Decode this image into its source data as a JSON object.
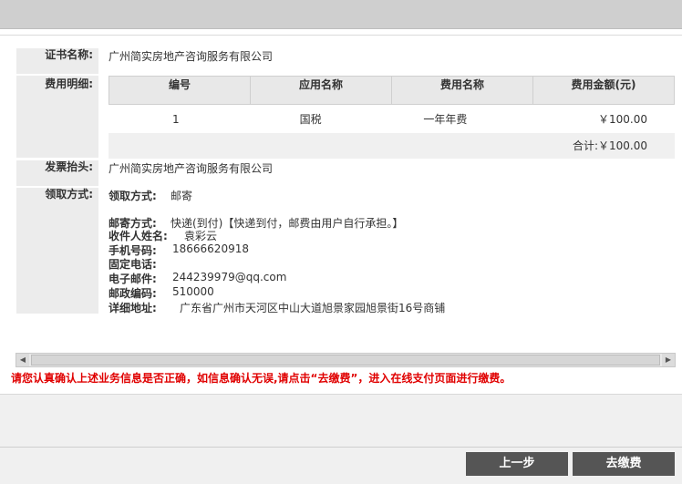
{
  "cert_name": {
    "label": "证书名称:",
    "value": "广州简实房地产咨询服务有限公司"
  },
  "fee_detail": {
    "label": "费用明细:",
    "columns": [
      "编号",
      "应用名称",
      "费用名称",
      "费用金额(元)"
    ],
    "rows": [
      {
        "no": "1",
        "app": "国税",
        "fee_name": "一年年费",
        "amount": "￥100.00"
      }
    ],
    "total_label": "合计:",
    "total": "￥100.00"
  },
  "invoice": {
    "label": "发票抬头:",
    "value": "广州简实房地产咨询服务有限公司"
  },
  "pickup": {
    "label": "领取方式:",
    "method_label": "领取方式:",
    "method_value": "邮寄",
    "mail_label": "邮寄方式:",
    "mail_value": "快递(到付)【快递到付，邮费由用户自行承担。】",
    "recipient_label": "收件人姓名:",
    "recipient_value": "袁彩云",
    "phone_label": "手机号码:",
    "phone_value": "18666620918",
    "tel_label": "固定电话:",
    "tel_value": "",
    "email_label": "电子邮件:",
    "email_value": "244239979@qq.com",
    "zip_label": "邮政编码:",
    "zip_value": "510000",
    "address_label": "详细地址:",
    "address_value": "广东省广州市天河区中山大道旭景家园旭景街16号商铺"
  },
  "notice": "请您认真确认上述业务信息是否正确，如信息确认无误,请点击“去缴费”，进入在线支付页面进行缴费。",
  "buttons": {
    "prev": "上一步",
    "pay": "去缴费"
  }
}
